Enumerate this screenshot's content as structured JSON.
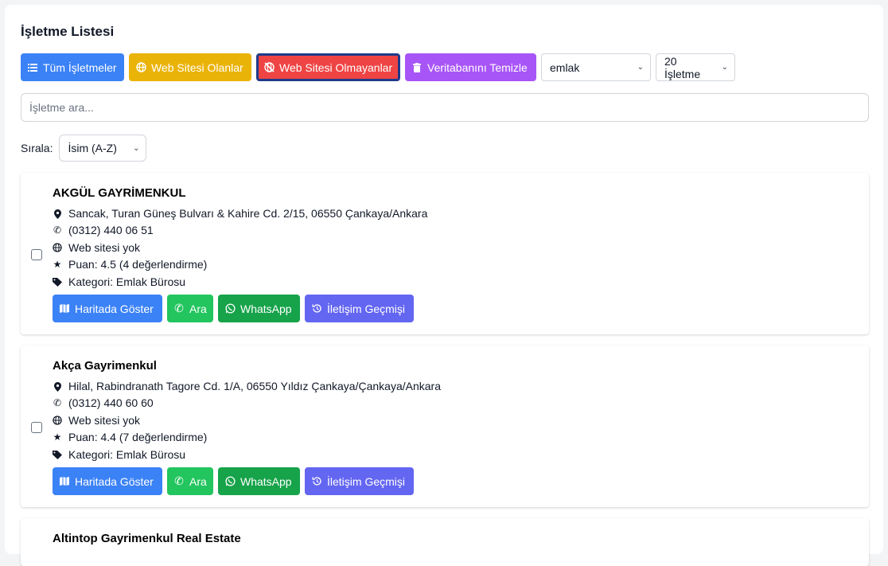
{
  "title": "İşletme Listesi",
  "toolbar": {
    "all_label": "Tüm İşletmeler",
    "with_web_label": "Web Sitesi Olanlar",
    "without_web_label": "Web Sitesi Olmayanlar",
    "clear_db_label": "Veritabanını Temizle",
    "category_select": "emlak",
    "count_select": "20 İşletme"
  },
  "search": {
    "placeholder": "İşletme ara..."
  },
  "sort": {
    "label": "Sırala:",
    "value": "İsim (A-Z)"
  },
  "actions": {
    "map": "Haritada Göster",
    "call": "Ara",
    "whatsapp": "WhatsApp",
    "history": "İletişim Geçmişi"
  },
  "businesses": [
    {
      "name": "AKGÜL GAYRİMENKUL",
      "address": "Sancak, Turan Güneş Bulvarı & Kahire Cd. 2/15, 06550 Çankaya/Ankara",
      "phone": "(0312) 440 06 51",
      "website": "Web sitesi yok",
      "rating": "Puan: 4.5 (4 değerlendirme)",
      "category": "Kategori: Emlak Bürosu"
    },
    {
      "name": "Akça Gayrimenkul",
      "address": "Hilal, Rabindranath Tagore Cd. 1/A, 06550 Yıldız Çankaya/Çankaya/Ankara",
      "phone": "(0312) 440 60 60",
      "website": "Web sitesi yok",
      "rating": "Puan: 4.4 (7 değerlendirme)",
      "category": "Kategori: Emlak Bürosu"
    },
    {
      "name": "Altintop Gayrimenkul Real Estate"
    }
  ],
  "colors": {
    "blue": "#3b82f6",
    "yellow": "#eab308",
    "red": "#ef4444",
    "purple": "#a855f7",
    "green": "#22c55e",
    "dark_green": "#16a34a",
    "indigo": "#6366f1"
  }
}
